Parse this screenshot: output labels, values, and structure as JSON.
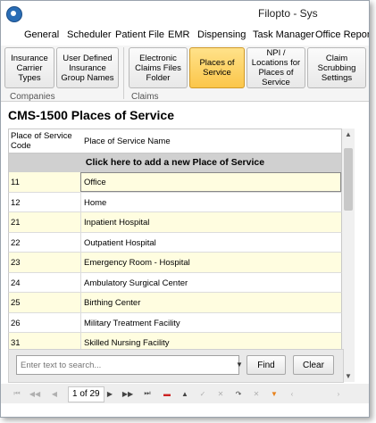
{
  "window": {
    "title": "Filopto - Sys"
  },
  "menu": [
    "General",
    "Scheduler",
    "Patient File",
    "EMR",
    "Dispensing",
    "Task Manager",
    "Office Report"
  ],
  "ribbon": {
    "buttons": [
      "Insurance Carrier Types",
      "User Defined Insurance Group Names",
      "Electronic Claims Files Folder",
      "Places of Service",
      "NPI / Locations for Places of Service",
      "Claim Scrubbing Settings"
    ],
    "groups": [
      "Companies",
      "Claims"
    ]
  },
  "page": {
    "title": "CMS-1500 Places of Service"
  },
  "grid": {
    "columns": [
      "Place of Service Code",
      "Place of Service Name"
    ],
    "add_row_label": "Click here to add a new Place of Service",
    "rows": [
      {
        "code": "11",
        "name": "Office"
      },
      {
        "code": "12",
        "name": "Home"
      },
      {
        "code": "21",
        "name": "Inpatient Hospital"
      },
      {
        "code": "22",
        "name": "Outpatient Hospital"
      },
      {
        "code": "23",
        "name": "Emergency Room - Hospital"
      },
      {
        "code": "24",
        "name": "Ambulatory Surgical Center"
      },
      {
        "code": "25",
        "name": "Birthing Center"
      },
      {
        "code": "26",
        "name": "Military Treatment Facility"
      },
      {
        "code": "31",
        "name": "Skilled Nursing Facility"
      }
    ]
  },
  "search": {
    "placeholder": "Enter text to search...",
    "find_label": "Find",
    "clear_label": "Clear"
  },
  "navigator": {
    "page_text": "1 of 29"
  },
  "colors": {
    "selected_tab": "#fbc64a",
    "alt_row": "#fffde0",
    "add_row": "#d0d0d0"
  }
}
